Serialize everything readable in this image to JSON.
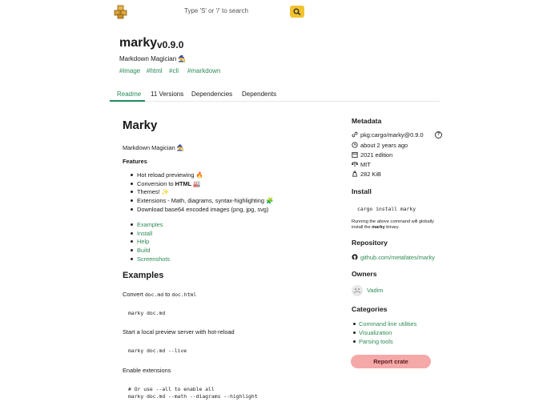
{
  "header": {
    "search_placeholder": "Type 'S' or '/' to search"
  },
  "crate": {
    "name": "marky",
    "version": "v0.9.0",
    "description": "Markdown Magician 🧙",
    "keywords": [
      "#image",
      "#html",
      "#cli",
      "#markdown"
    ]
  },
  "tabs": [
    {
      "label": "Readme"
    },
    {
      "label": "11 Versions"
    },
    {
      "label": "Dependencies"
    },
    {
      "label": "Dependents"
    }
  ],
  "readme": {
    "title": "Marky",
    "tagline": "Markdown Magician 🧙",
    "features_heading": "Features",
    "features": [
      "Hot reload previewing 🔥",
      "Conversion to",
      "HTML",
      "🏭",
      "Themes! ✨",
      "Extensions - Math, diagrams, syntax-highlighting 🧩",
      "Download base64 encoded images (png, jpg, svg)"
    ],
    "links": [
      "Examples",
      "Install",
      "Help",
      "Build",
      "Screenshots"
    ],
    "examples_heading": "Examples",
    "convert_text": "Convert",
    "convert_src": "doc.md",
    "convert_to": "to",
    "convert_dst": "doc.html",
    "code1": "marky doc.md",
    "preview_text": "Start a local preview server with hot-reload",
    "code2": "marky doc.md --live",
    "ext_text": "Enable extensions",
    "code3_line1": "# Or use --all to enable all",
    "code3_line2": "marky doc.md --math --diagrams --highlight"
  },
  "sidebar": {
    "metadata_heading": "Metadata",
    "purl": "pkg:cargo/marky@0.9.0",
    "age": "about 2 years ago",
    "edition": "2021 edition",
    "license": "MIT",
    "size": "282 KiB",
    "install_heading": "Install",
    "install_cmd": "cargo install marky",
    "install_note_1": "Running the above command will globally",
    "install_note_2a": "install the",
    "install_note_2b": "marky",
    "install_note_2c": "binary.",
    "repo_heading": "Repository",
    "repo_link": "github.com/metafates/marky",
    "owners_heading": "Owners",
    "owner_name": "Vadim",
    "categories_heading": "Categories",
    "categories": [
      "Command line utilities",
      "Visualization",
      "Parsing tools"
    ],
    "report_label": "Report crate"
  },
  "colors": {
    "accent_green": "#2e8b57",
    "search_button": "#f2c230",
    "report_button": "#f4a8a8"
  },
  "icons": [
    "cargo-logo-icon",
    "search-icon",
    "help-icon",
    "calendar-icon",
    "edition-icon",
    "license-icon",
    "weight-icon",
    "github-icon"
  ]
}
